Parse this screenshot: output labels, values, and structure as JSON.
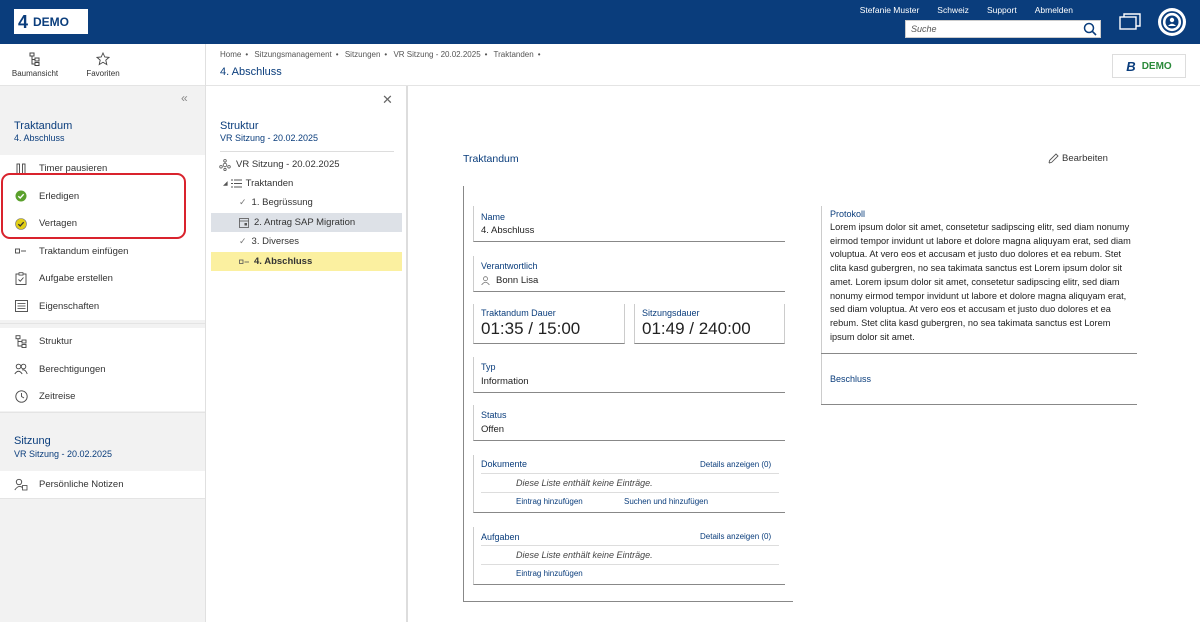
{
  "app": {
    "logo_num": "4",
    "logo_text": "DEMO"
  },
  "toplinks": [
    "Stefanie Muster",
    "Schweiz",
    "Support",
    "Abmelden"
  ],
  "search": {
    "placeholder": "Suche"
  },
  "quick": {
    "tree": "Baumansicht",
    "fav": "Favoriten"
  },
  "breadcrumb": [
    "Home",
    "Sitzungsmanagement",
    "Sitzungen",
    "VR Sitzung - 20.02.2025",
    "Traktanden"
  ],
  "page_title": "4. Abschluss",
  "brand": {
    "b": "B",
    "demo": "DEMO"
  },
  "left": {
    "traktandum_title": "Traktandum",
    "traktandum_sub": "4. Abschluss",
    "menu1": [
      "Timer pausieren",
      "Erledigen",
      "Vertagen",
      "Traktandum einfügen",
      "Aufgabe erstellen",
      "Eigenschaften"
    ],
    "menu2": [
      "Struktur",
      "Berechtigungen",
      "Zeitreise"
    ],
    "sitzung_title": "Sitzung",
    "sitzung_sub": "VR Sitzung - 20.02.2025",
    "menu3": [
      "Persönliche Notizen"
    ]
  },
  "structure": {
    "title": "Struktur",
    "sub": "VR Sitzung - 20.02.2025",
    "root": "VR Sitzung - 20.02.2025",
    "group": "Traktanden",
    "items": [
      "1. Begrüssung",
      "2. Antrag SAP Migration",
      "3. Diverses",
      "4. Abschluss"
    ]
  },
  "content": {
    "title": "Traktandum",
    "edit": "Bearbeiten",
    "name_label": "Name",
    "name_value": "4. Abschluss",
    "resp_label": "Verantwortlich",
    "resp_value": "Bonn Lisa",
    "dauer_label": "Traktandum Dauer",
    "dauer_value": "01:35 / 15:00",
    "sdauer_label": "Sitzungsdauer",
    "sdauer_value": "01:49 / 240:00",
    "typ_label": "Typ",
    "typ_value": "Information",
    "status_label": "Status",
    "status_value": "Offen",
    "docs_label": "Dokumente",
    "docs_details": "Details anzeigen (0)",
    "docs_empty": "Diese Liste enthält keine Einträge.",
    "docs_add": "Eintrag hinzufügen",
    "docs_search": "Suchen und hinzufügen",
    "tasks_label": "Aufgaben",
    "tasks_details": "Details anzeigen (0)",
    "tasks_empty": "Diese Liste enthält keine Einträge.",
    "tasks_add": "Eintrag hinzufügen",
    "proto_label": "Protokoll",
    "proto_text": "Lorem ipsum dolor sit amet, consetetur sadipscing elitr, sed diam nonumy eirmod tempor invidunt ut labore et dolore magna aliquyam erat, sed diam voluptua. At vero eos et accusam et justo duo dolores et ea rebum. Stet clita kasd gubergren, no sea takimata sanctus est Lorem ipsum dolor sit amet. Lorem ipsum dolor sit amet, consetetur sadipscing elitr, sed diam nonumy eirmod tempor invidunt ut labore et dolore magna aliquyam erat, sed diam voluptua. At vero eos et accusam et justo duo dolores et ea rebum. Stet clita kasd gubergren, no sea takimata sanctus est Lorem ipsum dolor sit amet.",
    "besch_label": "Beschluss"
  },
  "colors": {
    "primary": "#0a3d7c",
    "check_green": "#5aa02c",
    "check_yellow": "#e2cf17",
    "highlight": "#d9232d",
    "selected_yellow": "#fbf0a0"
  }
}
